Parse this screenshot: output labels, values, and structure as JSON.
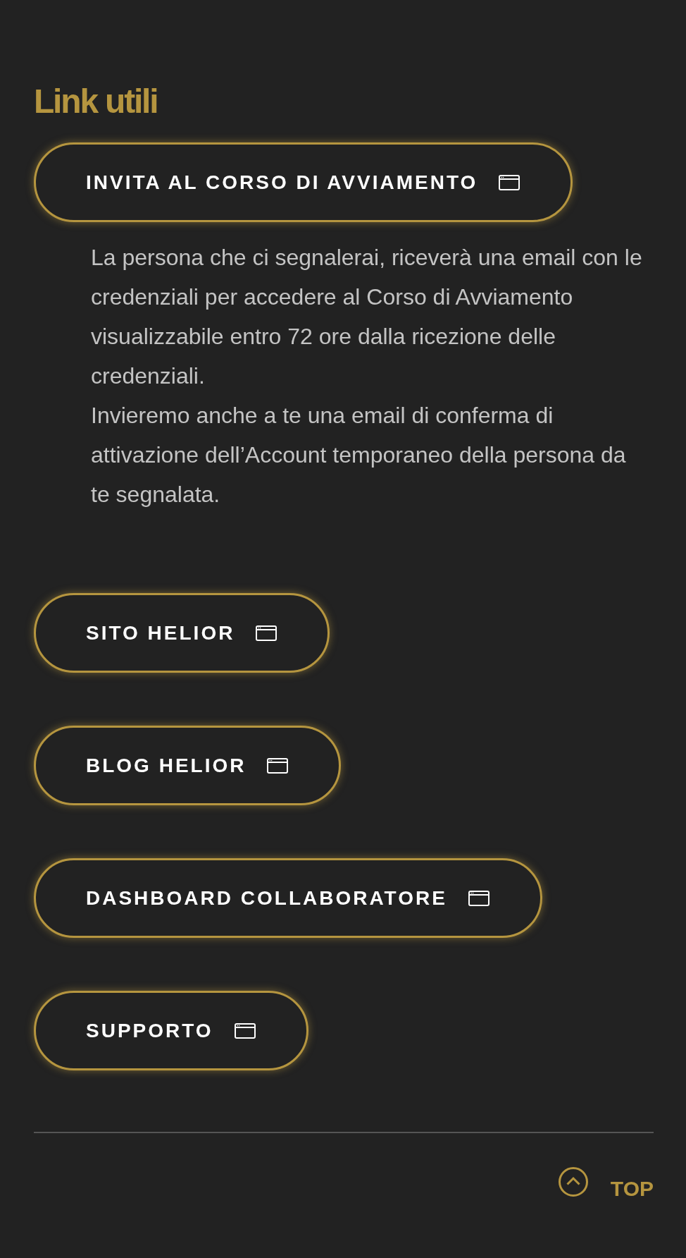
{
  "heading": "Link utili",
  "links": [
    {
      "label": "INVITA AL CORSO DI AVVIAMENTO",
      "description": [
        "La persona che ci segnalerai, riceverà una email con le credenziali per accedere al Corso di Avviamento visualizzabile entro 72 ore dalla ricezione delle credenziali.",
        "Invieremo anche a te una email di conferma di attivazione dell’Account temporaneo della persona da te segnalata."
      ]
    },
    {
      "label": "SITO HELIOR"
    },
    {
      "label": "BLOG HELIOR"
    },
    {
      "label": "DASHBOARD COLLABORATORE"
    },
    {
      "label": "SUPPORTO"
    }
  ],
  "back_to_top": {
    "label": "TOP"
  }
}
